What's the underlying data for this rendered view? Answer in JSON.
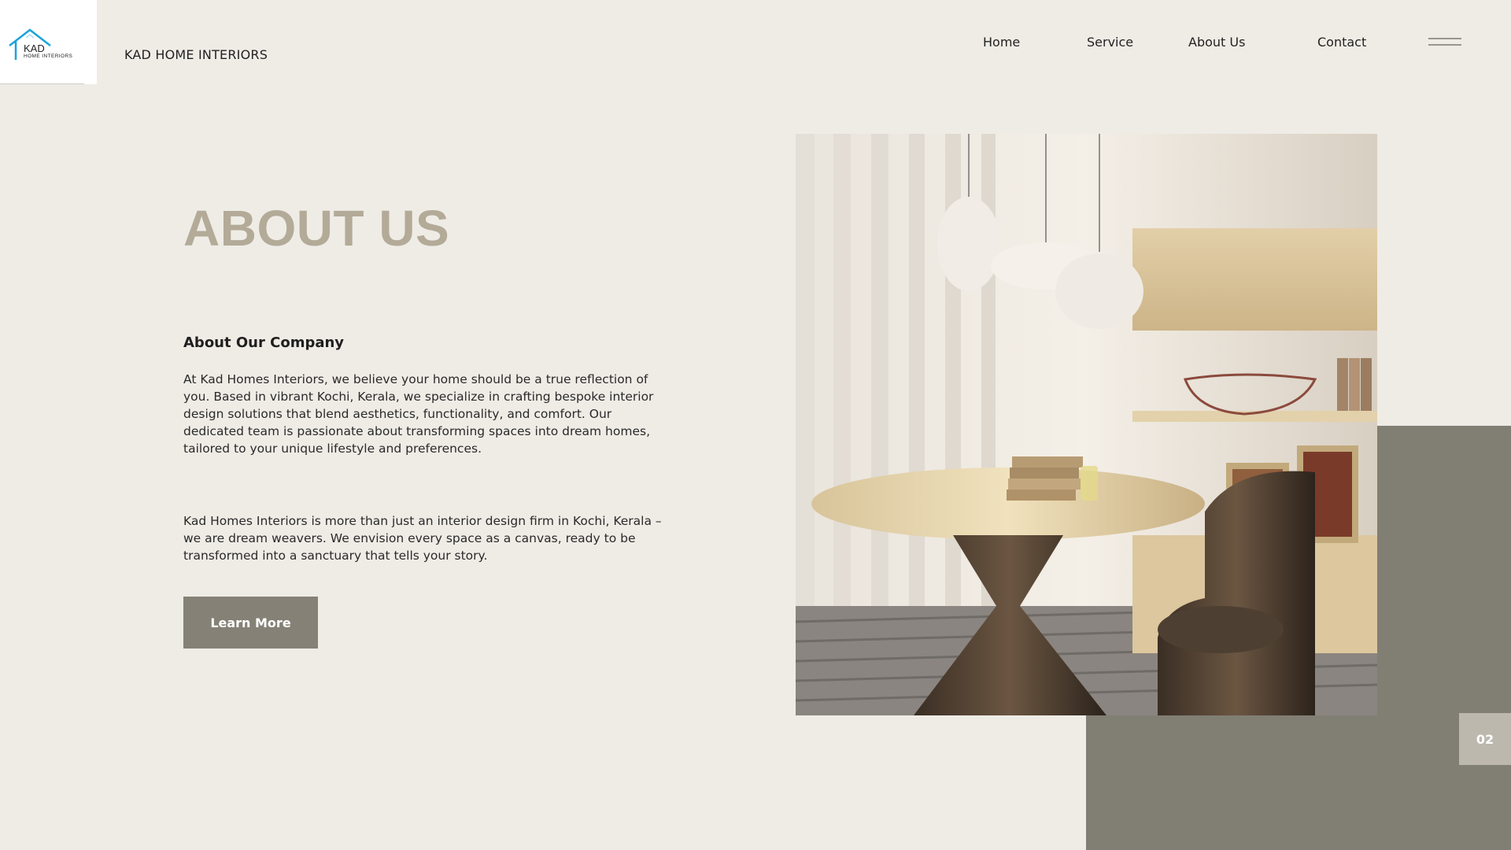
{
  "brand": {
    "logo_text": "KAD",
    "logo_subtext": "HOME INTERIORS",
    "name": "KAD HOME INTERIORS",
    "logo_color": "#1aa3d9"
  },
  "nav": {
    "items": [
      {
        "label": "Home"
      },
      {
        "label": "Service"
      },
      {
        "label": "About Us"
      },
      {
        "label": "Contact"
      }
    ],
    "menu_icon": "hamburger-icon"
  },
  "main": {
    "title": "ABOUT US",
    "subtitle": "About Our Company",
    "paragraph1": "At Kad Homes Interiors, we believe your home should be a true reflection of you. Based in vibrant Kochi, Kerala, we specialize in crafting bespoke interior design solutions that blend aesthetics, functionality, and comfort. Our dedicated team is passionate about transforming spaces into dream homes, tailored to your unique lifestyle and preferences.",
    "paragraph2": "Kad Homes Interiors is more than just an interior design firm in Kochi, Kerala – we are dream weavers. We envision every space as a canvas, ready to be transformed into a sanctuary that tells your story.",
    "cta_label": "Learn More"
  },
  "slide": {
    "page_number": "02"
  },
  "colors": {
    "background": "#efece6",
    "accent": "#858176",
    "heading": "#b3aa98",
    "page_badge": "#bdb8ae"
  }
}
